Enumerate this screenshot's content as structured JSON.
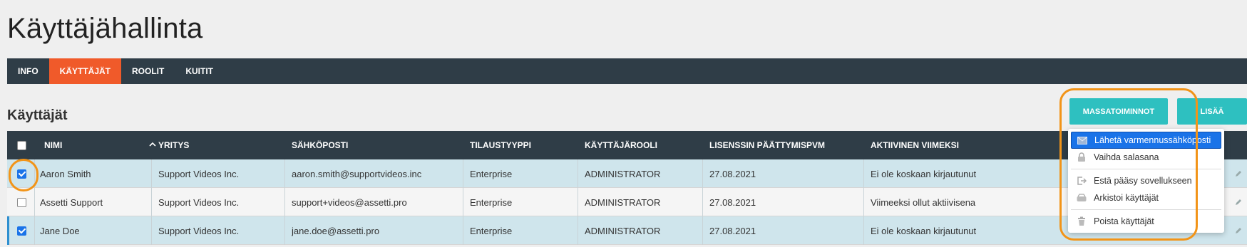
{
  "page": {
    "title": "Käyttäjähallinta"
  },
  "tabs": [
    {
      "label": "INFO",
      "active": false
    },
    {
      "label": "KÄYTTÄJÄT",
      "active": true
    },
    {
      "label": "ROOLIT",
      "active": false
    },
    {
      "label": "KUITIT",
      "active": false
    }
  ],
  "section": {
    "title": "Käyttäjät"
  },
  "buttons": {
    "mass_actions": "MASSATOIMINNOT",
    "add": "LISÄÄ"
  },
  "table": {
    "columns": [
      "NIMI",
      "YRITYS",
      "SÄHKÖPOSTI",
      "TILAUSTYYPPI",
      "KÄYTTÄJÄROOLI",
      "LISENSSIN PÄÄTTYMISPVM",
      "AKTIIVINEN VIIMEKSI"
    ],
    "sort": {
      "column": "NIMI",
      "direction": "ascending"
    },
    "rows": [
      {
        "checked": true,
        "name": "Aaron Smith",
        "company": "Support Videos Inc.",
        "email": "aaron.smith@supportvideos.inc",
        "subscription": "Enterprise",
        "role": "ADMINISTRATOR",
        "license_end": "27.08.2021",
        "last_active": "Ei ole koskaan kirjautunut"
      },
      {
        "checked": false,
        "name": "Assetti Support",
        "company": "Support Videos Inc.",
        "email": "support+videos@assetti.pro",
        "subscription": "Enterprise",
        "role": "ADMINISTRATOR",
        "license_end": "27.08.2021",
        "last_active": "Viimeeksi ollut aktiivisena"
      },
      {
        "checked": true,
        "name": "Jane Doe",
        "company": "Support Videos Inc.",
        "email": "jane.doe@assetti.pro",
        "subscription": "Enterprise",
        "role": "ADMINISTRATOR",
        "license_end": "27.08.2021",
        "last_active": "Ei ole koskaan kirjautunut"
      }
    ]
  },
  "dropdown": {
    "items": [
      {
        "label": "Lähetä varmennussähköposti",
        "icon": "envelope-icon",
        "highlighted": true
      },
      {
        "label": "Vaihda salasana",
        "icon": "lock-icon",
        "highlighted": false
      },
      {
        "label": "Estä pääsy sovellukseen",
        "icon": "sign-out-icon",
        "highlighted": false
      },
      {
        "label": "Arkistoi käyttäjät",
        "icon": "archive-icon",
        "highlighted": false
      },
      {
        "label": "Poista käyttäjät",
        "icon": "trash-icon",
        "highlighted": false
      }
    ]
  },
  "colors": {
    "header_bg": "#2f3d47",
    "active_tab": "#f05a2a",
    "button": "#2ec0c0",
    "row_selected": "#cfe5ec",
    "annotation": "#f29418",
    "menu_highlight": "#1a73e8"
  }
}
